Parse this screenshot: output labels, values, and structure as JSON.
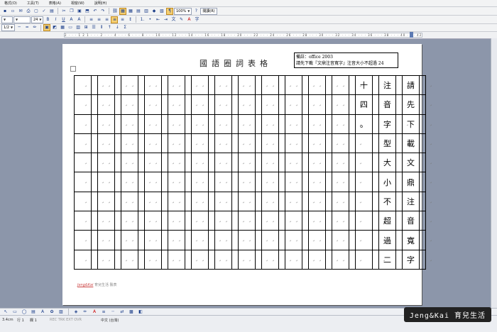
{
  "menu": [
    "格式(O)",
    "工具(T)",
    "表格(A)",
    "視窗(W)",
    "說明(H)"
  ],
  "toolbar": {
    "zoom": "100%",
    "read_label": "閱讀(R)",
    "font_size": "24",
    "style_level": "1/2"
  },
  "ruler": {
    "text": "2 · · · 1 2 1 · · · 2 · · · 4 · · · 6 · · · 8 · · · 10 · · · 12 · · · 14 · · · 16 · · · 18 · · · 20 · · · 22 · · · 24 · · · 26 · · · 28 · · · 30 · · · 32 · · · 34 · · · 36 · · · 38 · · · 40 · · · 42 · · · 44 · · · 46 · · · 48"
  },
  "document": {
    "title": "國語圈詞表格",
    "note_line1": "備註：office 2003",
    "note_line2": "請先下載『文鼎注音寬字』注音大小不超過 24",
    "columns": [
      {
        "chars": [
          "請",
          "先",
          "下",
          "載",
          "文",
          "鼎",
          "注",
          "音",
          "寬",
          "字"
        ]
      },
      {
        "chars": [
          "注",
          "音",
          "字",
          "型",
          "大",
          "小",
          "不",
          "超",
          "過",
          "二"
        ]
      },
      {
        "chars": [
          "十",
          "四",
          "。",
          "",
          "",
          "",
          "",
          "",
          "",
          ""
        ]
      }
    ],
    "empty_columns": 12,
    "footer_brand": "Jeng&Kai",
    "footer_text": "育兒生活 製表"
  },
  "status": {
    "position": "3.4cm",
    "line": "行 1",
    "col": "欄 1",
    "flags": "REC TRK EXT OVR",
    "language": "中文 (台灣)"
  },
  "watermark": "Jeng&Kai 育兒生活"
}
